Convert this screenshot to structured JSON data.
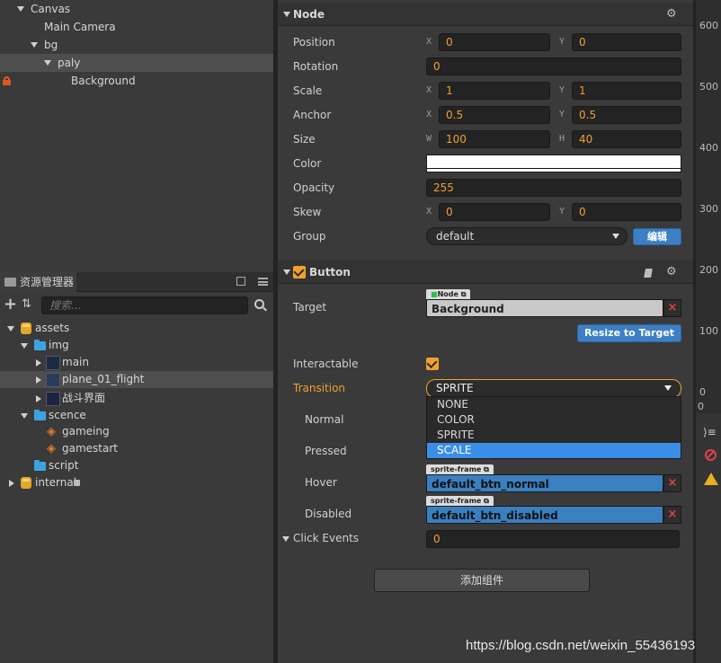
{
  "hierarchy": {
    "items": [
      {
        "label": "Canvas"
      },
      {
        "label": "Main Camera"
      },
      {
        "label": "bg"
      },
      {
        "label": "paly"
      },
      {
        "label": "Background"
      }
    ]
  },
  "assets": {
    "tab_label": "资源管理器",
    "search_placeholder": "搜索...",
    "items": [
      {
        "label": "assets"
      },
      {
        "label": "img"
      },
      {
        "label": "main"
      },
      {
        "label": "plane_01_flight"
      },
      {
        "label": "战斗界面"
      },
      {
        "label": "scence"
      },
      {
        "label": "gameing"
      },
      {
        "label": "gamestart"
      },
      {
        "label": "script"
      },
      {
        "label": "internal"
      }
    ]
  },
  "node": {
    "title": "Node",
    "position": {
      "label": "Position",
      "x_label": "X",
      "y_label": "Y",
      "x": "0",
      "y": "0"
    },
    "rotation": {
      "label": "Rotation",
      "value": "0"
    },
    "scale": {
      "label": "Scale",
      "x_label": "X",
      "y_label": "Y",
      "x": "1",
      "y": "1"
    },
    "anchor": {
      "label": "Anchor",
      "x_label": "X",
      "y_label": "Y",
      "x": "0.5",
      "y": "0.5"
    },
    "size": {
      "label": "Size",
      "w_label": "W",
      "h_label": "H",
      "w": "100",
      "h": "40"
    },
    "color": {
      "label": "Color",
      "value": "#ffffff"
    },
    "opacity": {
      "label": "Opacity",
      "value": "255"
    },
    "skew": {
      "label": "Skew",
      "x_label": "X",
      "y_label": "Y",
      "x": "0",
      "y": "0"
    },
    "group": {
      "label": "Group",
      "value": "default",
      "edit_label": "编辑"
    }
  },
  "button": {
    "title": "Button",
    "target": {
      "label": "Target",
      "tag": "Node",
      "value": "Background"
    },
    "resize_label": "Resize to Target",
    "interactable_label": "Interactable",
    "transition": {
      "label": "Transition",
      "value": "SPRITE",
      "options": [
        "NONE",
        "COLOR",
        "SPRITE",
        "SCALE"
      ],
      "highlighted": "SCALE"
    },
    "normal_label": "Normal",
    "pressed_label": "Pressed",
    "hover": {
      "label": "Hover",
      "tag": "sprite-frame",
      "value": "default_btn_normal"
    },
    "disabled": {
      "label": "Disabled",
      "tag": "sprite-frame",
      "value": "default_btn_disabled"
    },
    "click_events": {
      "label": "Click Events",
      "value": "0"
    }
  },
  "add_component_label": "添加组件",
  "ruler": {
    "ticks": [
      "600",
      "500",
      "400",
      "300",
      "200",
      "100",
      "0",
      "0"
    ]
  },
  "watermark": "https://blog.csdn.net/weixin_55436193",
  "colors": {
    "accent": "#f0a030",
    "selection": "#3a8ee6",
    "button_blue": "#3d7fc4",
    "panel": "#3a3a3a"
  }
}
